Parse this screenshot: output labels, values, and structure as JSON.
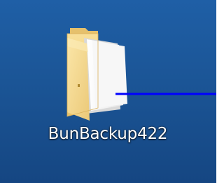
{
  "desktop": {
    "background_color": "#1b5596",
    "icons": [
      {
        "label": "BunBackup422",
        "icon": "folder-icon",
        "folder_color": "#f4d37c",
        "paper_color": "#ffffff"
      }
    ]
  },
  "annotation": {
    "pointer_line_color": "#0000ff"
  }
}
